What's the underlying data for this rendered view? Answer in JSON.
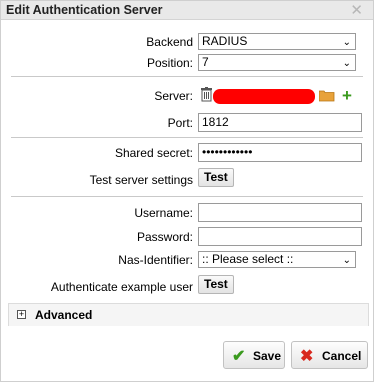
{
  "dialog": {
    "title": "Edit Authentication Server"
  },
  "form": {
    "backend": {
      "label": "Backend",
      "value": "RADIUS"
    },
    "position": {
      "label": "Position:",
      "value": "7"
    },
    "server": {
      "label": "Server:"
    },
    "port": {
      "label": "Port:",
      "value": "1812"
    },
    "shared_secret": {
      "label": "Shared secret:",
      "value": "••••••••••••"
    },
    "test_server": {
      "label": "Test server settings",
      "button": "Test"
    },
    "username": {
      "label": "Username:",
      "value": ""
    },
    "password": {
      "label": "Password:",
      "value": ""
    },
    "nas_identifier": {
      "label": "Nas-Identifier:",
      "value": ":: Please select ::"
    },
    "auth_example": {
      "label": "Authenticate example user",
      "button": "Test"
    }
  },
  "advanced": {
    "label": "Advanced"
  },
  "footer": {
    "save_label": "Save",
    "cancel_label": "Cancel"
  },
  "colors": {
    "redaction": "#ff0000",
    "add_green": "#3a9a1e",
    "folder": "#e8a23a",
    "cancel_red": "#d8281e"
  }
}
